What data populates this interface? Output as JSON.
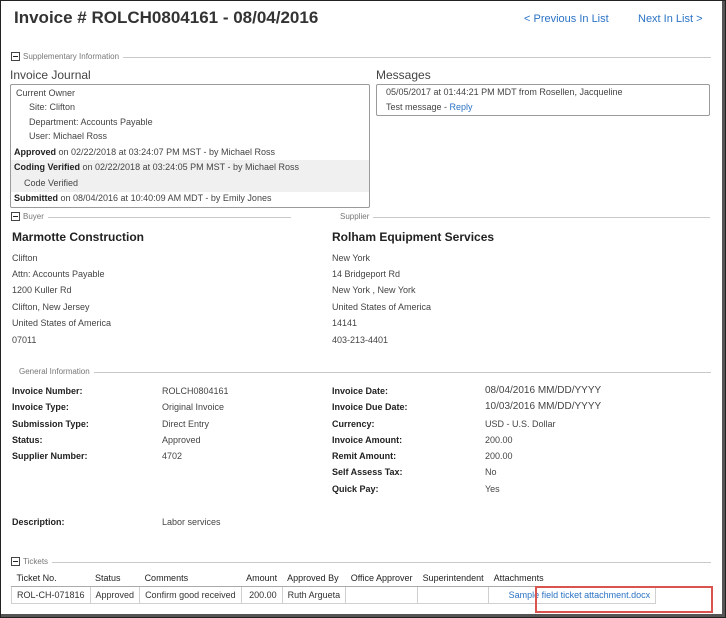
{
  "header": {
    "title": "Invoice # ROLCH0804161 - 08/04/2016",
    "prev_link": "< Previous In List",
    "next_link": "Next In List >"
  },
  "supplementary": {
    "legend": "Supplementary Information",
    "journal_title": "Invoice Journal",
    "journal": {
      "owner_label": "Current Owner",
      "site": "Site: Clifton",
      "department": "Department: Accounts Payable",
      "user": "User: Michael Ross",
      "approved_label": "Approved",
      "approved_text": " on 02/22/2018 at 03:24:07 PM MST - by Michael Ross",
      "coding_label": "Coding Verified",
      "coding_text": " on 02/22/2018 at 03:24:05 PM MST - by Michael Ross",
      "code_verified": "Code Verified",
      "submitted_label": "Submitted",
      "submitted_text": " on 08/04/2016 at 10:40:09 AM MDT - by Emily Jones"
    },
    "messages_title": "Messages",
    "message": {
      "meta": "05/05/2017 at 01:44:21 PM MDT  from Rosellen, Jacqueline",
      "body": "Test message - ",
      "reply": "Reply"
    }
  },
  "buyer": {
    "legend": "Buyer",
    "name": "Marmotte Construction",
    "lines": [
      "Clifton",
      "Attn:  Accounts Payable",
      "1200 Kuller Rd",
      "Clifton, New Jersey",
      "United States of America",
      "07011"
    ]
  },
  "supplier": {
    "legend": "Supplier",
    "name": "Rolham Equipment Services",
    "lines": [
      "New York",
      "14 Bridgeport Rd",
      "New York ,  New York",
      "United States of America",
      "14141",
      "403-213-4401"
    ]
  },
  "general": {
    "legend": "General Information",
    "left": [
      {
        "label": "Invoice Number:",
        "value": "ROLCH0804161"
      },
      {
        "label": "Invoice Type:",
        "value": "Original Invoice"
      },
      {
        "label": "Submission Type:",
        "value": "Direct Entry"
      },
      {
        "label": "Status:",
        "value": "Approved"
      },
      {
        "label": "Supplier Number:",
        "value": "4702"
      }
    ],
    "right": [
      {
        "label": "Invoice Date:",
        "value": "08/04/2016  MM/DD/YYYY"
      },
      {
        "label": "Invoice Due Date:",
        "value": "10/03/2016  MM/DD/YYYY"
      },
      {
        "label": "Currency:",
        "value": "USD - U.S. Dollar"
      },
      {
        "label": "Invoice Amount:",
        "value": "200.00"
      },
      {
        "label": "Remit Amount:",
        "value": "200.00"
      },
      {
        "label": "Self Assess Tax:",
        "value": "No"
      },
      {
        "label": "Quick Pay:",
        "value": "Yes"
      }
    ],
    "description_label": "Description:",
    "description_value": "Labor services"
  },
  "tickets": {
    "legend": "Tickets",
    "columns": [
      "Ticket No.",
      "Status",
      "Comments",
      "Amount",
      "Approved By",
      "Office Approver",
      "Superintendent",
      "Attachments"
    ],
    "rows": [
      {
        "ticket_no": "ROL-CH-071816",
        "status": "Approved",
        "comments": "Confirm good received",
        "amount": "200.00",
        "approved_by": "Ruth Argueta",
        "office_approver": "",
        "superintendent": "",
        "attachment": "Sample field ticket attachment.docx"
      }
    ]
  }
}
